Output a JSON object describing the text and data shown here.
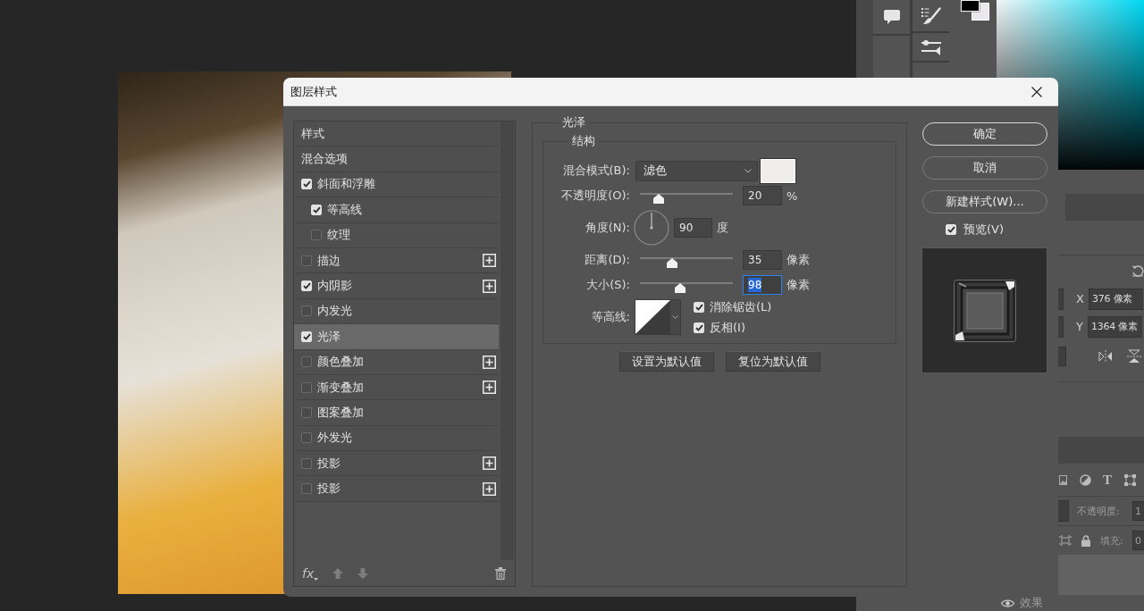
{
  "dialog": {
    "title": "图层样式",
    "styles": [
      {
        "kind": "header",
        "label": "样式",
        "selected": false
      },
      {
        "kind": "header",
        "label": "混合选项",
        "selected": false
      },
      {
        "kind": "effect",
        "label": "斜面和浮雕",
        "checked": true,
        "selected": false,
        "addable": false,
        "children": [
          {
            "kind": "effect",
            "label": "等高线",
            "checked": true,
            "selected": false,
            "addable": false
          },
          {
            "kind": "effect",
            "label": "纹理",
            "checked": false,
            "selected": false,
            "addable": false
          }
        ]
      },
      {
        "kind": "effect",
        "label": "描边",
        "checked": false,
        "selected": false,
        "addable": true
      },
      {
        "kind": "effect",
        "label": "内阴影",
        "checked": true,
        "selected": false,
        "addable": true
      },
      {
        "kind": "effect",
        "label": "内发光",
        "checked": false,
        "selected": false,
        "addable": false
      },
      {
        "kind": "effect",
        "label": "光泽",
        "checked": true,
        "selected": true,
        "addable": false
      },
      {
        "kind": "effect",
        "label": "颜色叠加",
        "checked": false,
        "selected": false,
        "addable": true
      },
      {
        "kind": "effect",
        "label": "渐变叠加",
        "checked": false,
        "selected": false,
        "addable": true
      },
      {
        "kind": "effect",
        "label": "图案叠加",
        "checked": false,
        "selected": false,
        "addable": false
      },
      {
        "kind": "effect",
        "label": "外发光",
        "checked": false,
        "selected": false,
        "addable": false
      },
      {
        "kind": "effect",
        "label": "投影",
        "checked": false,
        "selected": false,
        "addable": true
      },
      {
        "kind": "effect",
        "label": "投影",
        "checked": false,
        "selected": false,
        "addable": true
      }
    ],
    "fx_label": "fx",
    "section": {
      "title": "光泽",
      "group": "结构",
      "rows": [
        {
          "kind": "select",
          "label": "混合模式(B):",
          "value": "滤色"
        },
        {
          "kind": "slider",
          "label": "不透明度(O):",
          "value": "20",
          "unit": "%",
          "level": 0.2,
          "focused": false
        },
        {
          "kind": "dial",
          "label": "角度(N):",
          "value": "90",
          "unit": "度",
          "focused": false
        },
        {
          "kind": "slider",
          "label": "距离(D):",
          "value": "35",
          "unit": "像素",
          "level": 0.35,
          "focused": false
        },
        {
          "kind": "slider",
          "label": "大小(S):",
          "value": "98",
          "unit": "像素",
          "level": 0.43,
          "focused": true
        },
        {
          "kind": "contour",
          "label": "等高线:",
          "options": [
            {
              "label": "消除锯齿(L)",
              "checked": true
            },
            {
              "label": "反相(I)",
              "checked": true
            }
          ]
        }
      ],
      "buttons": [
        "设置为默认值",
        "复位为默认值"
      ]
    },
    "actions": [
      {
        "label": "确定",
        "default": true
      },
      {
        "label": "取消",
        "default": false
      },
      {
        "label": "新建样式(W)...",
        "default": false
      }
    ],
    "preview": {
      "label": "预览(V)",
      "checked": true
    }
  },
  "properties": {
    "x_label": "X",
    "x_value": "376 像素",
    "y_label": "Y",
    "y_value": "1364 像素"
  },
  "layers": {
    "filter_glyph": "T",
    "opacity_label": "不透明度:",
    "opacity_value": "1",
    "fill_label": "填充:",
    "fill_value": "0",
    "effects_label": "效果"
  }
}
